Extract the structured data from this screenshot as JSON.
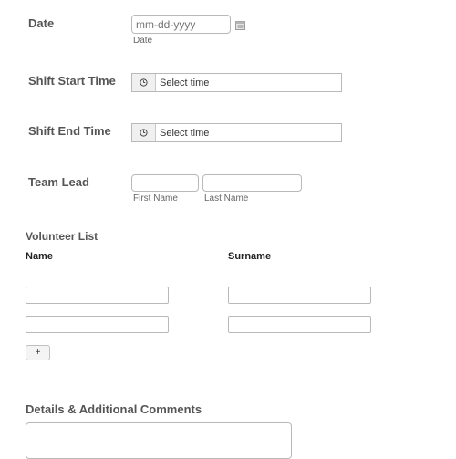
{
  "date": {
    "label": "Date",
    "placeholder": "mm-dd-yyyy",
    "sublabel": "Date",
    "calendar_icon": "calendar-icon"
  },
  "shift_start": {
    "label": "Shift Start Time",
    "placeholder": "Select time",
    "icon": "clock-icon"
  },
  "shift_end": {
    "label": "Shift End Time",
    "placeholder": "Select time",
    "icon": "clock-icon"
  },
  "team_lead": {
    "label": "Team Lead",
    "first_sublabel": "First Name",
    "last_sublabel": "Last Name"
  },
  "volunteer_list": {
    "title": "Volunteer List",
    "columns": [
      "Name",
      "Surname"
    ],
    "rows": [
      {
        "name": "",
        "surname": ""
      },
      {
        "name": "",
        "surname": ""
      }
    ],
    "add_label": "+"
  },
  "details": {
    "label": "Details & Additional Comments",
    "value": ""
  }
}
